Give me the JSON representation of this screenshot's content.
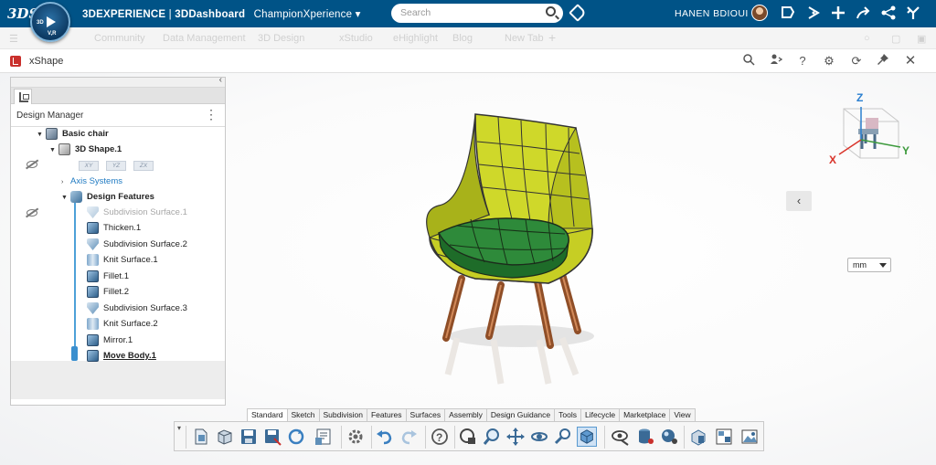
{
  "topbar": {
    "brand_bold": "3DEXPERIENCE",
    "brand_sep": " | ",
    "brand_app": "3DDashboard",
    "tenant": "ChampionXperience",
    "search_placeholder": "Search",
    "user_name": "HANEN BDIOUI",
    "compass_labels": [
      "3D",
      "V,R"
    ],
    "colors": {
      "bar": "#005387",
      "text": "#ffffff"
    }
  },
  "tabstrip": {
    "tabs": [
      "Community",
      "Data Management",
      "3D Design",
      "xStudio",
      "eHighlight",
      "Blog",
      "New Tab"
    ]
  },
  "app": {
    "title": "xShape",
    "header_icons": [
      "search-icon",
      "share-user-icon",
      "help-icon",
      "settings-icon",
      "refresh-icon",
      "pin-icon",
      "close-icon"
    ]
  },
  "panel": {
    "title": "Design Manager",
    "tree": [
      {
        "label": "Basic chair",
        "icon": "part-icon",
        "style": "bold"
      },
      {
        "label": "3D Shape.1",
        "icon": "shape-icon",
        "style": "bold"
      },
      {
        "planes": [
          "XY",
          "YZ",
          "ZX"
        ]
      },
      {
        "label": "Axis Systems",
        "style": "link"
      },
      {
        "label": "Design Features",
        "style": "bold"
      },
      {
        "label": "Subdivision Surface.1",
        "style": "faded"
      },
      {
        "label": "Thicken.1"
      },
      {
        "label": "Subdivision Surface.2"
      },
      {
        "label": "Knit Surface.1"
      },
      {
        "label": "Fillet.1"
      },
      {
        "label": "Fillet.2"
      },
      {
        "label": "Subdivision Surface.3"
      },
      {
        "label": "Knit Surface.2"
      },
      {
        "label": "Mirror.1"
      },
      {
        "label": "Move Body.1",
        "style": "underline"
      }
    ]
  },
  "viewport": {
    "unit": "mm",
    "axes": {
      "x": "X",
      "y": "Y",
      "z": "Z"
    },
    "colors": {
      "seat": "#2e8a3a",
      "shell": "#c9d221",
      "legs": "#b0643a",
      "axis_x": "#d9342b",
      "axis_y": "#3c9a3c",
      "axis_z": "#2a7fd0"
    }
  },
  "actionbar": {
    "tabs": [
      "Standard",
      "Sketch",
      "Subdivision",
      "Features",
      "Surfaces",
      "Assembly",
      "Design Guidance",
      "Tools",
      "Lifecycle",
      "Marketplace",
      "View"
    ],
    "active_tab": "Standard",
    "tools": [
      "new-icon",
      "open-icon",
      "save-icon",
      "save-as-icon",
      "update-icon",
      "properties-icon",
      "settings-icon",
      "undo-icon",
      "redo-icon",
      "help-icon",
      "rotate-lock-icon",
      "zoom-icon",
      "pan-icon",
      "rotate-icon",
      "zoom-area-icon",
      "view-cube-icon",
      "hide-show-icon",
      "database-icon",
      "render-icon",
      "box-icon",
      "layout-icon",
      "image-icon"
    ]
  }
}
